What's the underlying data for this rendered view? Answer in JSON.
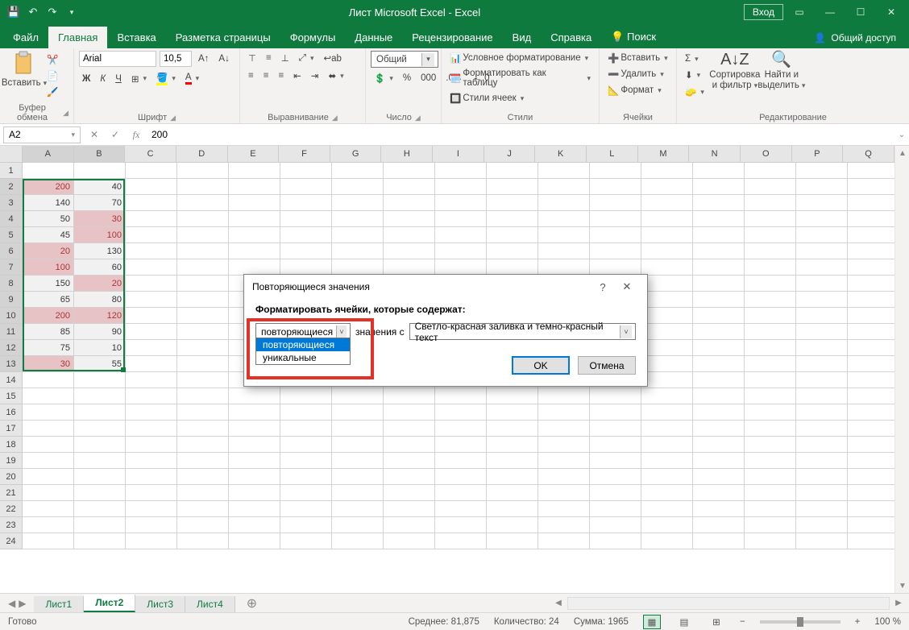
{
  "titlebar": {
    "title": "Лист Microsoft Excel  -  Excel",
    "signin": "Вход"
  },
  "tabs": {
    "items": [
      "Файл",
      "Главная",
      "Вставка",
      "Разметка страницы",
      "Формулы",
      "Данные",
      "Рецензирование",
      "Вид",
      "Справка"
    ],
    "active_index": 1,
    "tellme": "Поиск",
    "share": "Общий доступ"
  },
  "ribbon": {
    "clipboard": {
      "paste": "Вставить",
      "label": "Буфер обмена"
    },
    "font": {
      "name": "Arial",
      "size": "10,5",
      "label": "Шрифт",
      "bold": "Ж",
      "italic": "К",
      "underline": "Ч"
    },
    "align": {
      "label": "Выравнивание"
    },
    "number": {
      "format": "Общий",
      "label": "Число"
    },
    "styles": {
      "cond": "Условное форматирование",
      "table": "Форматировать как таблицу",
      "cell": "Стили ячеек",
      "label": "Стили"
    },
    "cells": {
      "insert": "Вставить",
      "delete": "Удалить",
      "format": "Формат",
      "label": "Ячейки"
    },
    "editing": {
      "sort": "Сортировка и фильтр",
      "find": "Найти и выделить",
      "label": "Редактирование"
    }
  },
  "formula": {
    "name": "A2",
    "value": "200"
  },
  "columns": [
    "A",
    "B",
    "C",
    "D",
    "E",
    "F",
    "G",
    "H",
    "I",
    "J",
    "K",
    "L",
    "M",
    "N",
    "O",
    "P",
    "Q"
  ],
  "sel_cols": [
    0,
    1
  ],
  "sel_rows_from": 2,
  "sel_rows_to": 13,
  "data": {
    "A": [
      null,
      200,
      140,
      50,
      45,
      20,
      100,
      150,
      65,
      200,
      85,
      75,
      30
    ],
    "B": [
      null,
      40,
      70,
      30,
      100,
      130,
      60,
      20,
      80,
      120,
      90,
      10,
      55
    ]
  },
  "highlight": {
    "A": [
      2,
      6,
      7,
      10,
      13
    ],
    "B": [
      4,
      5,
      8,
      10
    ]
  },
  "sheets": {
    "items": [
      "Лист1",
      "Лист2",
      "Лист3",
      "Лист4"
    ],
    "active_index": 1
  },
  "status": {
    "ready": "Готово",
    "avg_label": "Среднее:",
    "avg": "81,875",
    "count_label": "Количество:",
    "count": "24",
    "sum_label": "Сумма:",
    "sum": "1965",
    "zoom": "100 %"
  },
  "dialog": {
    "title": "Повторяющиеся значения",
    "prompt": "Форматировать ячейки, которые содержат:",
    "combo_value": "повторяющиеся",
    "options": [
      "повторяющиеся",
      "уникальные"
    ],
    "mid": "значения с",
    "format_value": "Светло-красная заливка и темно-красный текст",
    "ok": "OK",
    "cancel": "Отмена"
  }
}
